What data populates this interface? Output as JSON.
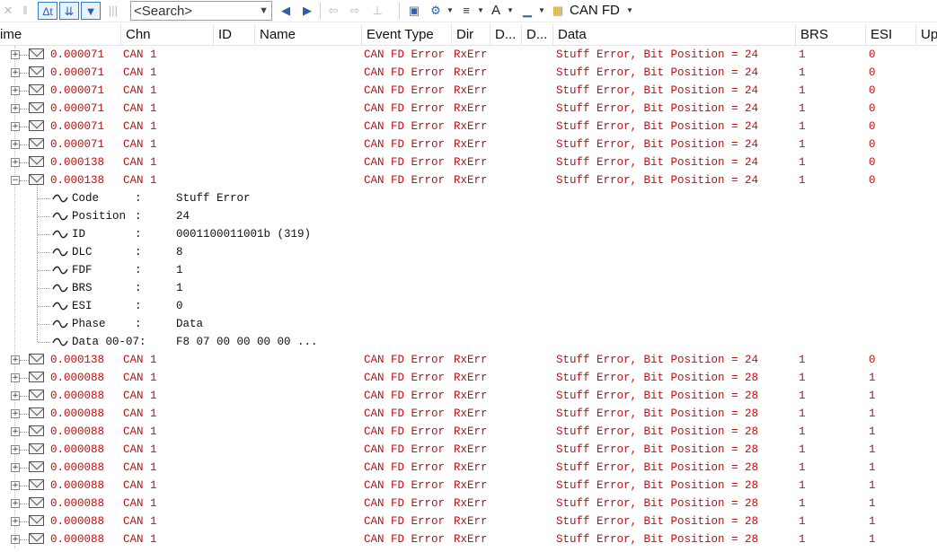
{
  "toolbar": {
    "search_placeholder": "<Search>",
    "channel_label": "CAN FD",
    "icons": [
      {
        "name": "clear-icon",
        "glyph": "✕"
      },
      {
        "name": "pause-icon",
        "glyph": "‖"
      },
      {
        "name": "delta-time-icon",
        "glyph": "Δt"
      },
      {
        "name": "scroll-down-icon",
        "glyph": "⇊"
      },
      {
        "name": "filter-view-icon",
        "glyph": "▼"
      },
      {
        "name": "bars-icon",
        "glyph": "|||"
      },
      {
        "name": "find-prev-icon",
        "glyph": "◀"
      },
      {
        "name": "find-next-icon",
        "glyph": "▶"
      },
      {
        "name": "back-icon",
        "glyph": "⇦"
      },
      {
        "name": "forward-icon",
        "glyph": "⇨"
      },
      {
        "name": "marker-icon",
        "glyph": "⊥"
      },
      {
        "name": "message-window-icon",
        "glyph": "▣"
      },
      {
        "name": "config-icon",
        "glyph": "⚙"
      },
      {
        "name": "line-style-icon",
        "glyph": "≡"
      },
      {
        "name": "font-size-icon",
        "glyph": "A"
      },
      {
        "name": "layout-icon",
        "glyph": "▁"
      },
      {
        "name": "channel-icon",
        "glyph": "▦"
      }
    ]
  },
  "columns": [
    "ime",
    "Chn",
    "ID",
    "Name",
    "Event Type",
    "Dir",
    "D...",
    "D...",
    "Data",
    "BRS",
    "ESI",
    "Up"
  ],
  "rows": [
    {
      "time": "0.000071",
      "chn": "CAN 1",
      "event": "CAN FD Error",
      "dir": "RxErr",
      "data": "Stuff Error, Bit Position = 24",
      "brs": "1",
      "esi": "0",
      "expanded": false
    },
    {
      "time": "0.000071",
      "chn": "CAN 1",
      "event": "CAN FD Error",
      "dir": "RxErr",
      "data": "Stuff Error, Bit Position = 24",
      "brs": "1",
      "esi": "0",
      "expanded": false
    },
    {
      "time": "0.000071",
      "chn": "CAN 1",
      "event": "CAN FD Error",
      "dir": "RxErr",
      "data": "Stuff Error, Bit Position = 24",
      "brs": "1",
      "esi": "0",
      "expanded": false
    },
    {
      "time": "0.000071",
      "chn": "CAN 1",
      "event": "CAN FD Error",
      "dir": "RxErr",
      "data": "Stuff Error, Bit Position = 24",
      "brs": "1",
      "esi": "0",
      "expanded": false
    },
    {
      "time": "0.000071",
      "chn": "CAN 1",
      "event": "CAN FD Error",
      "dir": "RxErr",
      "data": "Stuff Error, Bit Position = 24",
      "brs": "1",
      "esi": "0",
      "expanded": false
    },
    {
      "time": "0.000071",
      "chn": "CAN 1",
      "event": "CAN FD Error",
      "dir": "RxErr",
      "data": "Stuff Error, Bit Position = 24",
      "brs": "1",
      "esi": "0",
      "expanded": false
    },
    {
      "time": "0.000138",
      "chn": "CAN 1",
      "event": "CAN FD Error",
      "dir": "RxErr",
      "data": "Stuff Error, Bit Position = 24",
      "brs": "1",
      "esi": "0",
      "expanded": false
    },
    {
      "time": "0.000138",
      "chn": "CAN 1",
      "event": "CAN FD Error",
      "dir": "RxErr",
      "data": "Stuff Error, Bit Position = 24",
      "brs": "1",
      "esi": "0",
      "expanded": true
    },
    {
      "time": "0.000138",
      "chn": "CAN 1",
      "event": "CAN FD Error",
      "dir": "RxErr",
      "data": "Stuff Error, Bit Position = 24",
      "brs": "1",
      "esi": "0",
      "expanded": false
    },
    {
      "time": "0.000088",
      "chn": "CAN 1",
      "event": "CAN FD Error",
      "dir": "RxErr",
      "data": "Stuff Error, Bit Position = 28",
      "brs": "1",
      "esi": "1",
      "expanded": false
    },
    {
      "time": "0.000088",
      "chn": "CAN 1",
      "event": "CAN FD Error",
      "dir": "RxErr",
      "data": "Stuff Error, Bit Position = 28",
      "brs": "1",
      "esi": "1",
      "expanded": false
    },
    {
      "time": "0.000088",
      "chn": "CAN 1",
      "event": "CAN FD Error",
      "dir": "RxErr",
      "data": "Stuff Error, Bit Position = 28",
      "brs": "1",
      "esi": "1",
      "expanded": false
    },
    {
      "time": "0.000088",
      "chn": "CAN 1",
      "event": "CAN FD Error",
      "dir": "RxErr",
      "data": "Stuff Error, Bit Position = 28",
      "brs": "1",
      "esi": "1",
      "expanded": false
    },
    {
      "time": "0.000088",
      "chn": "CAN 1",
      "event": "CAN FD Error",
      "dir": "RxErr",
      "data": "Stuff Error, Bit Position = 28",
      "brs": "1",
      "esi": "1",
      "expanded": false
    },
    {
      "time": "0.000088",
      "chn": "CAN 1",
      "event": "CAN FD Error",
      "dir": "RxErr",
      "data": "Stuff Error, Bit Position = 28",
      "brs": "1",
      "esi": "1",
      "expanded": false
    },
    {
      "time": "0.000088",
      "chn": "CAN 1",
      "event": "CAN FD Error",
      "dir": "RxErr",
      "data": "Stuff Error, Bit Position = 28",
      "brs": "1",
      "esi": "1",
      "expanded": false
    },
    {
      "time": "0.000088",
      "chn": "CAN 1",
      "event": "CAN FD Error",
      "dir": "RxErr",
      "data": "Stuff Error, Bit Position = 28",
      "brs": "1",
      "esi": "1",
      "expanded": false
    },
    {
      "time": "0.000088",
      "chn": "CAN 1",
      "event": "CAN FD Error",
      "dir": "RxErr",
      "data": "Stuff Error, Bit Position = 28",
      "brs": "1",
      "esi": "1",
      "expanded": false
    },
    {
      "time": "0.000088",
      "chn": "CAN 1",
      "event": "CAN FD Error",
      "dir": "RxErr",
      "data": "Stuff Error, Bit Position = 28",
      "brs": "1",
      "esi": "1",
      "expanded": false
    }
  ],
  "details": [
    {
      "label": "Code",
      "sep": ":",
      "value": "Stuff Error"
    },
    {
      "label": "Position",
      "sep": ":",
      "value": "24"
    },
    {
      "label": "ID",
      "sep": ":",
      "value": "0001100011001b (319)"
    },
    {
      "label": "DLC",
      "sep": ":",
      "value": "8"
    },
    {
      "label": "FDF",
      "sep": ":",
      "value": "1"
    },
    {
      "label": "BRS",
      "sep": ":",
      "value": "1"
    },
    {
      "label": "ESI",
      "sep": ":",
      "value": "0"
    },
    {
      "label": "Phase",
      "sep": ":",
      "value": "Data"
    },
    {
      "label": "Data 00-07:",
      "sep": "",
      "value": "F8 07 00 00 00 00  ..."
    }
  ],
  "colors": {
    "error_text": "#c01010",
    "detail_text": "#111111",
    "accent": "#2f7fd0"
  }
}
